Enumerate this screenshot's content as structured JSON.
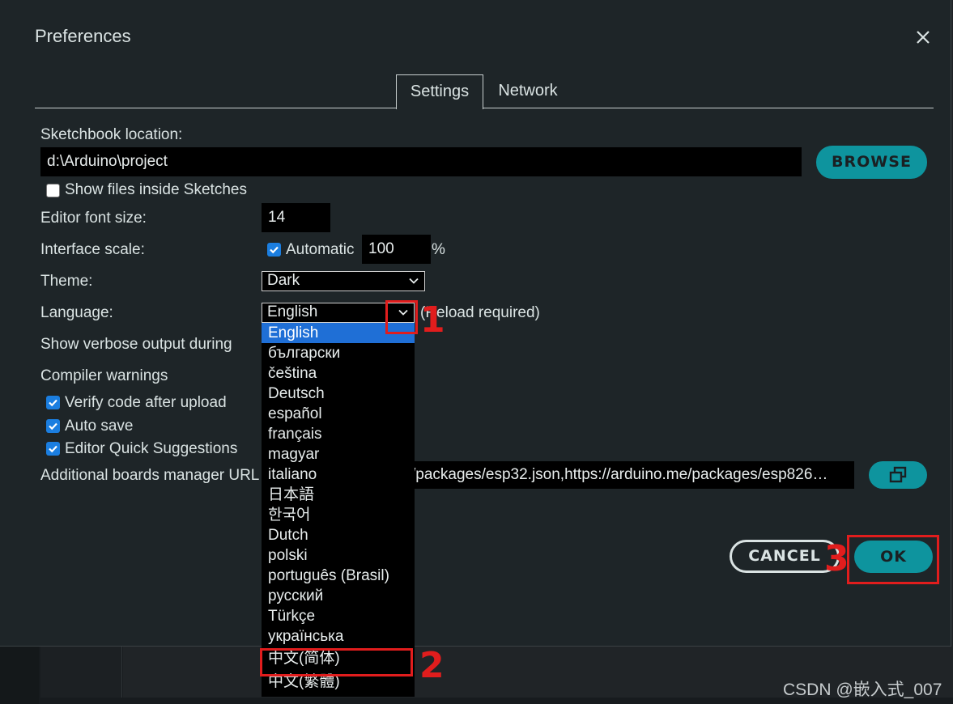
{
  "dialog": {
    "title": "Preferences",
    "tabs": [
      {
        "label": "Settings",
        "active": true
      },
      {
        "label": "Network",
        "active": false
      }
    ]
  },
  "settings": {
    "sketchbook_label": "Sketchbook location:",
    "sketchbook_value": "d:\\Arduino\\project",
    "browse_label": "BROWSE",
    "show_files_label": "Show files inside Sketches",
    "show_files_checked": false,
    "font_size_label": "Editor font size:",
    "font_size_value": "14",
    "scale_label": "Interface scale:",
    "scale_automatic_label": "Automatic",
    "scale_automatic_checked": true,
    "scale_value": "100",
    "scale_unit": "%",
    "theme_label": "Theme:",
    "theme_value": "Dark",
    "language_label": "Language:",
    "language_value": "English",
    "reload_note": "(Reload required)",
    "verbose_label": "Show verbose output during",
    "compiler_warnings_label": "Compiler warnings",
    "verify_label": "Verify code after upload",
    "verify_checked": true,
    "autosave_label": "Auto save",
    "autosave_checked": true,
    "quick_suggestions_label": "Editor Quick Suggestions",
    "quick_suggestions_checked": true,
    "boards_url_label": "Additional boards manager URL",
    "boards_url_value": "/packages/esp32.json,https://arduino.me/packages/esp826…"
  },
  "language_options": [
    "English",
    "български",
    "čeština",
    "Deutsch",
    "español",
    "français",
    "magyar",
    "italiano",
    "日本語",
    "한국어",
    "Dutch",
    "polski",
    "português (Brasil)",
    "русский",
    "Türkçe",
    "українська",
    "中文(简体)",
    "中文(繁體)"
  ],
  "footer": {
    "cancel_label": "CANCEL",
    "ok_label": "OK"
  },
  "annotations": {
    "step1": "1",
    "step2": "2",
    "step3": "3"
  },
  "watermark": "CSDN @嵌入式_007",
  "colors": {
    "accent": "#0e949e",
    "background": "#1e2528",
    "annotation_red": "#e11d1d",
    "selected": "#1f6fd6"
  }
}
